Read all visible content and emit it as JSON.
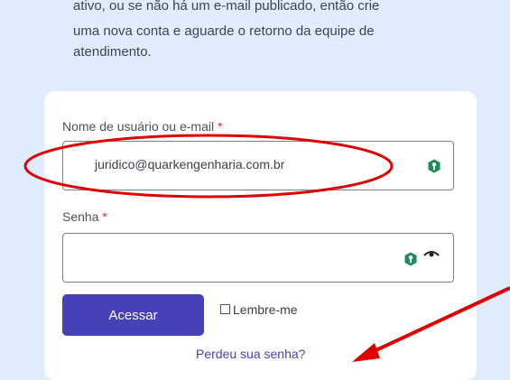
{
  "intro": {
    "line1": "ativo, ou se não há um e-mail publicado, então crie",
    "line2": "uma nova conta e aguarde o retorno da equipe de",
    "line3": "atendimento."
  },
  "login": {
    "username_label": "Nome de usuário ou e-mail",
    "username_value": "juridico@quarkengenharia.com.br",
    "password_label": "Senha",
    "required_mark": "*",
    "submit_label": "Acessar",
    "remember_label": "Lembre-me",
    "lost_password_link": "Perdeu sua senha?"
  },
  "icons": {
    "password_manager": "key-badge-icon",
    "show_password": "eye-icon"
  },
  "colors": {
    "accent": "#4741b7",
    "annotation": "#e00000",
    "required": "#d93025",
    "page_bg": "#e2ecff"
  }
}
